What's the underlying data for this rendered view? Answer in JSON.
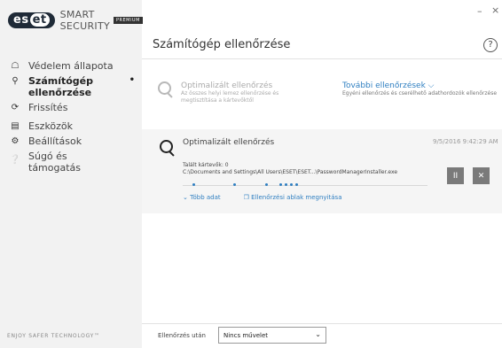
{
  "app": {
    "brand_left": "es",
    "brand_right": "et",
    "product": "SMART SECURITY",
    "edition": "PREMIUM",
    "tagline": "ENJOY SAFER TECHNOLOGY™"
  },
  "window": {
    "minimize": "–",
    "close": "×"
  },
  "sidebar": {
    "items": [
      {
        "label": "Védelem állapota",
        "icon": "home-icon"
      },
      {
        "label": "Számítógép ellenőrzése",
        "icon": "search-icon",
        "active": true,
        "indicator": "•"
      },
      {
        "label": "Frissítés",
        "icon": "refresh-icon"
      },
      {
        "label": "Eszközök",
        "icon": "toolbox-icon"
      },
      {
        "label": "Beállítások",
        "icon": "gear-icon"
      },
      {
        "label": "Súgó és támogatás",
        "icon": "info-icon"
      }
    ]
  },
  "main": {
    "title": "Számítógép ellenőrzése",
    "help": "?",
    "optimized": {
      "title": "Optimalizált ellenőrzés",
      "description": "Az összes helyi lemez ellenőrzése és megtisztítása a kártevőktől"
    },
    "more": {
      "title": "További ellenőrzések",
      "chevron": "⌵",
      "description": "Egyéni ellenőrzés és cserélhető adathordozók ellenőrzése"
    },
    "task": {
      "title": "Optimalizált ellenőrzés",
      "time": "9/5/2016 9:42:29 AM",
      "threats": "Talált kártevők: 0",
      "path": "C:\\Documents and Settings\\All Users\\ESET\\ESET...\\PasswordManagerInstaller.exe",
      "more_label": "Több adat",
      "open_label": "Ellenőrzési ablak megnyitása",
      "pause": "II",
      "stop": "✕"
    }
  },
  "footer": {
    "after_label": "Ellenőrzés után",
    "action_value": "Nincs művelet"
  },
  "colors": {
    "link": "#2f7fc1",
    "sidebar_bg": "#f2f2f2",
    "task_bg": "#f5f5f5"
  }
}
